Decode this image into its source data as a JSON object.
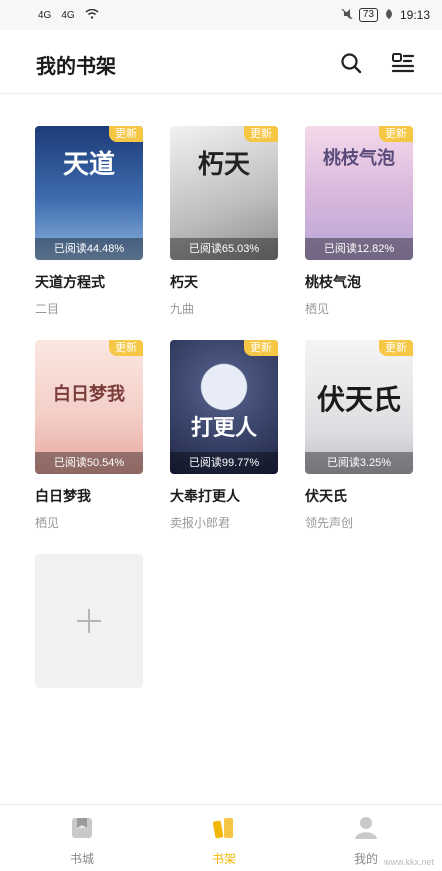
{
  "status": {
    "time": "19:13",
    "battery": "73",
    "signal1": "4G",
    "signal2": "4G"
  },
  "header": {
    "title": "我的书架"
  },
  "books": [
    {
      "title": "天道方程式",
      "author": "二目",
      "progress": "已阅读44.48%",
      "badge": "更新",
      "cover_text": "天道",
      "cover_bg": "#2f4f8a",
      "cover_fg": "#ffffff"
    },
    {
      "title": "朽天",
      "author": "九曲",
      "progress": "已阅读65.03%",
      "badge": "更新",
      "cover_text": "朽天",
      "cover_bg": "#cfcfcf",
      "cover_fg": "#222222"
    },
    {
      "title": "桃枝气泡",
      "author": "栖见",
      "progress": "已阅读12.82%",
      "badge": "更新",
      "cover_text": "桃枝气泡",
      "cover_bg": "#e6c9df",
      "cover_fg": "#5a4a7a"
    },
    {
      "title": "白日梦我",
      "author": "栖见",
      "progress": "已阅读50.54%",
      "badge": "更新",
      "cover_text": "白日梦我",
      "cover_bg": "#f3d9d6",
      "cover_fg": "#7a3b3b"
    },
    {
      "title": "大奉打更人",
      "author": "卖报小郎君",
      "progress": "已阅读99.77%",
      "badge": "更新",
      "cover_text": "打更人",
      "cover_bg": "#2c3556",
      "cover_fg": "#ffffff"
    },
    {
      "title": "伏天氏",
      "author": "领先声创",
      "progress": "已阅读3.25%",
      "badge": "更新",
      "cover_text": "伏天氏",
      "cover_bg": "#e9eaec",
      "cover_fg": "#1a1a1a"
    }
  ],
  "add_button": "+",
  "tabs": [
    {
      "label": "书城",
      "icon": "book-store-icon"
    },
    {
      "label": "书架",
      "icon": "bookshelf-icon"
    },
    {
      "label": "我的",
      "icon": "profile-icon"
    }
  ],
  "accent_color": "#f2b705",
  "watermark": "www.kkx.net"
}
